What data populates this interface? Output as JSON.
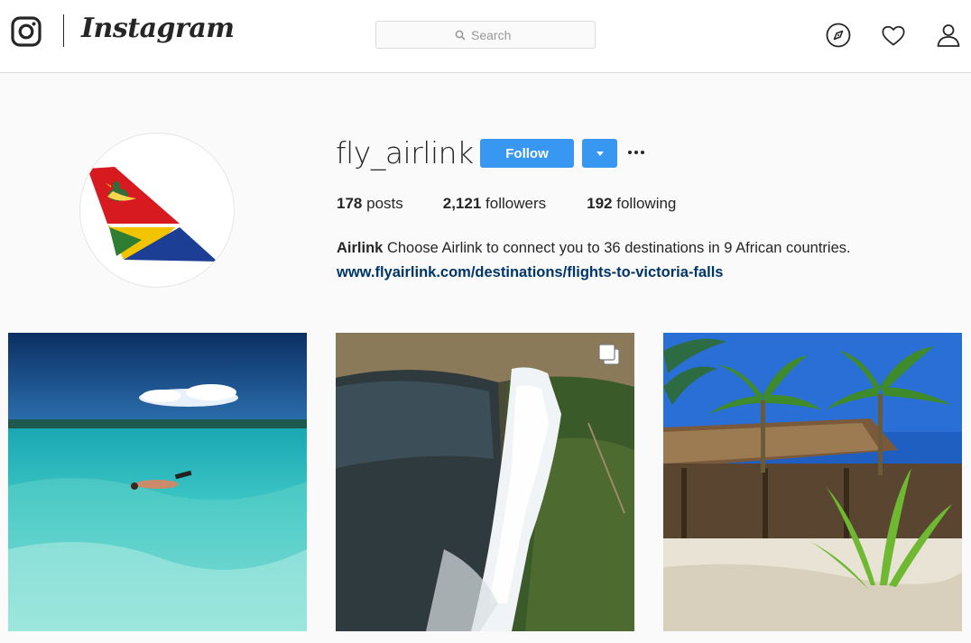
{
  "nav": {
    "wordmark": "Instagram",
    "search_placeholder": "Search"
  },
  "profile": {
    "username": "fly_airlink",
    "follow_label": "Follow",
    "stats": {
      "posts_count": "178",
      "posts_label": "posts",
      "followers_count": "2,121",
      "followers_label": "followers",
      "following_count": "192",
      "following_label": "following"
    },
    "full_name": "Airlink",
    "bio": "Choose Airlink to connect you to 36 destinations in 9 African countries.",
    "website": "www.flyairlink.com/destinations/flights-to-victoria-falls"
  },
  "posts": [
    {
      "subject": "snorkeler in turquoise lagoon"
    },
    {
      "subject": "aerial view of Victoria Falls",
      "multi": true
    },
    {
      "subject": "thatched lodge with palm trees"
    }
  ],
  "colors": {
    "accent": "#3897f0",
    "link": "#003569",
    "text": "#262626",
    "background": "#fafafa"
  },
  "icons": [
    "instagram-glyph-icon",
    "search-icon",
    "explore-compass-icon",
    "heart-icon",
    "profile-person-icon",
    "chevron-down-icon",
    "more-options-icon",
    "carousel-multi-icon"
  ]
}
